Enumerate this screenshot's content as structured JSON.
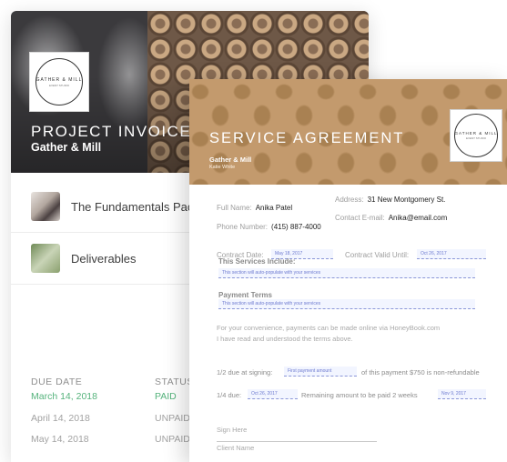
{
  "invoice": {
    "logo_text": "GATHER & MILL",
    "logo_sub": "EVENT STUDIO",
    "title": "PROJECT INVOICE",
    "subtitle": "Gather & Mill",
    "items": [
      {
        "label": "The Fundamentals Package"
      },
      {
        "label": "Deliverables"
      }
    ],
    "columns": {
      "due_date": "DUE DATE",
      "status": "STATUS"
    },
    "payments": [
      {
        "date": "March 14, 2018",
        "status": "PAID"
      },
      {
        "date": "April 14, 2018",
        "status": "UNPAID"
      },
      {
        "date": "May 14, 2018",
        "status": "UNPAID"
      }
    ]
  },
  "agreement": {
    "title": "SERVICE AGREEMENT",
    "company": "Gather & Mill",
    "person": "Katie White",
    "logo_text": "GATHER & MILL",
    "logo_sub": "EVENT STUDIO",
    "full_name_label": "Full Name:",
    "full_name": "Anika Patel",
    "address_label": "Address:",
    "address": "31 New Montgomery St.",
    "phone_label": "Phone Number:",
    "phone": "(415) 887-4000",
    "email_label": "Contact E-mail:",
    "email": "Anika@email.com",
    "contract_date_label": "Contract Date:",
    "contract_date": "May 18, 2017",
    "valid_until_label": "Contract Valid Until:",
    "valid_until": "Oct 26, 2017",
    "services_title": "This Services Include:",
    "services_placeholder": "This section will auto-populate with your services",
    "payment_title": "Payment Terms",
    "payment_placeholder": "This section will auto-populate with your services",
    "convenience_text": "For your convenience, payments can be made online via HoneyBook.com",
    "terms_text": "I have read and understood the terms above.",
    "half_label": "1/2 due at signing:",
    "half_field": "First payment amount",
    "half_text": "of this payment $750 is non-refundable",
    "quarter_label": "1/4 due:",
    "quarter_date": "Oct 26, 2017",
    "quarter_text": "Remaining amount to be paid 2 weeks",
    "quarter_date2": "Nov 9, 2017",
    "sign_here": "Sign Here",
    "client_name": "Client Name"
  },
  "colors": {
    "paid": "#55b37c",
    "agreement_header": "#c39a6d",
    "field_accent": "#8a96d8"
  }
}
